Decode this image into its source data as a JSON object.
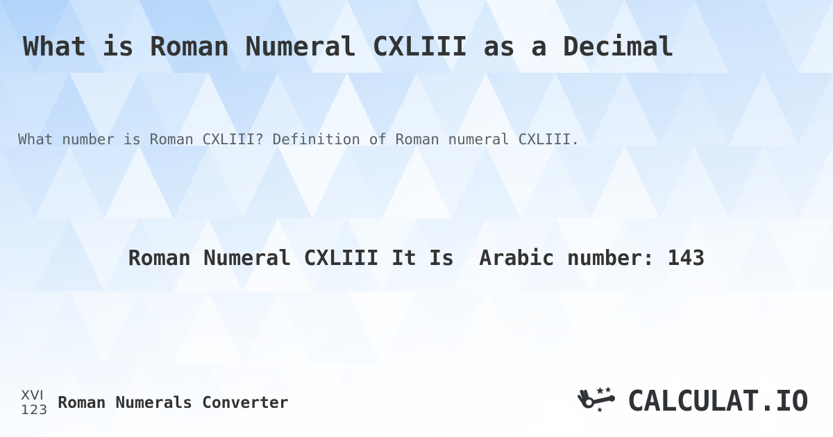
{
  "page": {
    "title": "What is Roman Numeral CXLIII as a Decimal",
    "subtitle": "What number is Roman CXLIII? Definition of Roman numeral CXLIII."
  },
  "answer": {
    "text": "Roman Numeral CXLIII It Is  Arabic number: 143",
    "roman": "CXLIII",
    "arabic": "143"
  },
  "footer": {
    "brand_mark_top": "XVI",
    "brand_mark_bottom": "123",
    "brand_name": "Roman Numerals Converter",
    "site_logo_text": "CALCULAT.IO",
    "site_logo_icon": "magic-wand-hand-icon"
  },
  "colors": {
    "text_dark": "#333333",
    "text_muted": "#5a5f66",
    "bg_blue": "#bfdcfb",
    "bg_light": "#ffffff",
    "logo_dark": "#2f3337"
  }
}
